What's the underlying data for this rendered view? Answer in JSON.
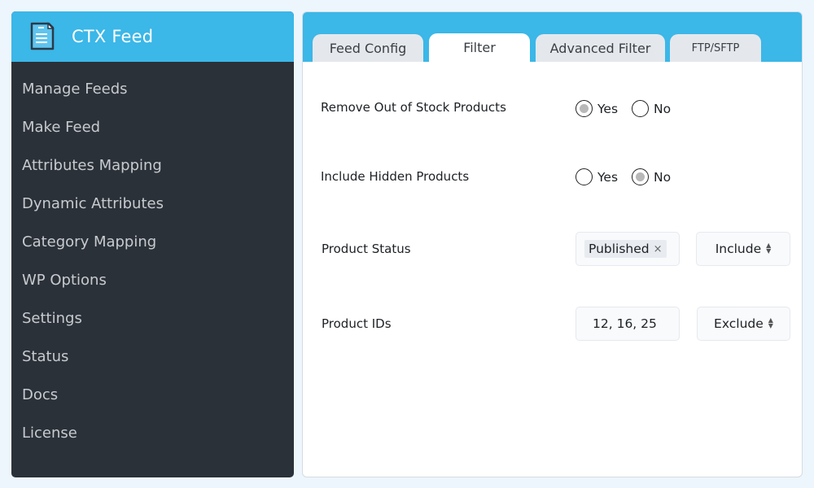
{
  "app": {
    "title": "CTX Feed",
    "brand_color": "#3bb7e8",
    "sidebar_bg": "#2b3138"
  },
  "sidebar": {
    "items": [
      {
        "label": "Manage Feeds"
      },
      {
        "label": "Make Feed"
      },
      {
        "label": "Attributes Mapping"
      },
      {
        "label": "Dynamic Attributes"
      },
      {
        "label": "Category Mapping"
      },
      {
        "label": "WP Options"
      },
      {
        "label": "Settings"
      },
      {
        "label": "Status"
      },
      {
        "label": "Docs"
      },
      {
        "label": "License"
      }
    ]
  },
  "tabs": [
    {
      "label": "Feed Config",
      "active": false
    },
    {
      "label": "Filter",
      "active": true
    },
    {
      "label": "Advanced Filter",
      "active": false
    },
    {
      "label": "FTP/SFTP",
      "active": false
    }
  ],
  "filter": {
    "remove_out_of_stock": {
      "label": "Remove Out of Stock Products",
      "options": [
        "Yes",
        "No"
      ],
      "selected": "Yes"
    },
    "include_hidden": {
      "label": "Include Hidden Products",
      "options": [
        "Yes",
        "No"
      ],
      "selected": "No"
    },
    "product_status": {
      "label": "Product Status",
      "tags": [
        "Published"
      ],
      "tag_remove_glyph": "×",
      "mode": "Include"
    },
    "product_ids": {
      "label": "Product IDs",
      "value": "12, 16, 25",
      "mode": "Exclude"
    }
  },
  "icons": {
    "select_arrow_up": "▲",
    "select_arrow_down": "▼"
  }
}
